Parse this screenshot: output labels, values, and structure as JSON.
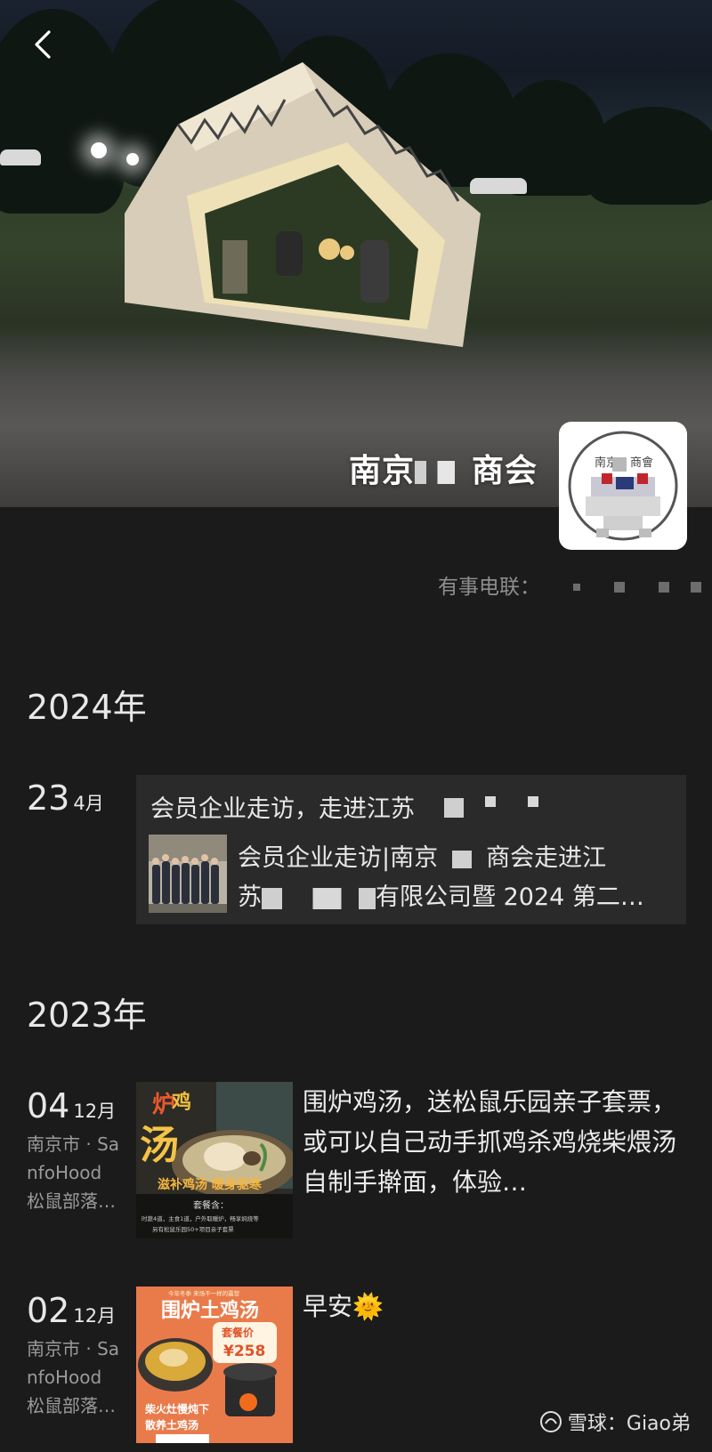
{
  "header": {
    "title_left": "南京",
    "title_right": "商会",
    "avatar_text_left": "南京",
    "avatar_text_right": "商會",
    "contact_label": "有事电联："
  },
  "timeline": {
    "y2024": {
      "year": "2024年",
      "post1": {
        "day": "23",
        "month": "4月",
        "headline": "会员企业走访，走进江苏",
        "article_line1": "会员企业走访|南京",
        "article_line1_end": "商会走进江",
        "article_line2_start": "苏",
        "article_line2_end": "有限公司暨 2024 第二…"
      }
    },
    "y2023": {
      "year": "2023年",
      "post1": {
        "day": "04",
        "month": "12月",
        "location_line1": "南京市 · Sa",
        "location_line2": "nfoHood",
        "location_line3": "松鼠部落…",
        "text": "围炉鸡汤，送松鼠乐园亲子套票，或可以自己动手抓鸡杀鸡烧柴煨汤自制手擀面，体验…",
        "img_title_top": "炉",
        "img_title_mid": "鸡",
        "img_title_big": "汤",
        "img_banner": "滋补鸡汤 暖身驱寒",
        "img_package_title": "套餐含：",
        "img_package_line1": "时蔬4道，主食1道，户外取暖炉，畅享焖烧等",
        "img_package_line2": "另有松鼠乐园50+项目亲子套票"
      },
      "post2": {
        "day": "02",
        "month": "12月",
        "location_line1": "南京市 · Sa",
        "location_line2": "nfoHood",
        "location_line3": "松鼠部落…",
        "text": "早安",
        "emoji": "🌞",
        "img_top_small": "今年冬季 来场不一样的露营",
        "img_title": "围炉土鸡汤",
        "img_price_label": "套餐价",
        "img_price": "¥258",
        "img_bottom1": "柴火灶慢炖下",
        "img_bottom2": "散养土鸡汤"
      }
    }
  },
  "watermark": {
    "brand": "雪球：Giao弟"
  },
  "colors": {
    "background": "#1b1b1b",
    "card": "#2a2a2a",
    "poster_orange": "#e97b4b"
  }
}
